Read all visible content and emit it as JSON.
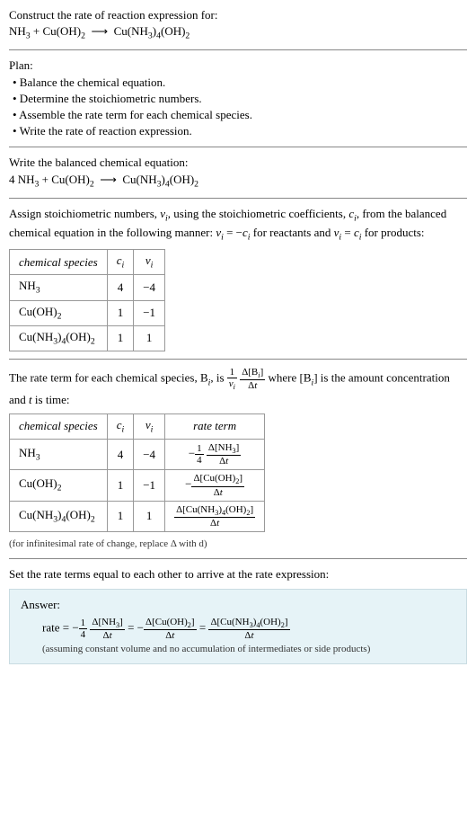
{
  "header": {
    "title": "Construct the rate of reaction expression for:",
    "equation_html": "NH<sub>3</sub> + Cu(OH)<sub>2</sub>&nbsp; ⟶ &nbsp;Cu(NH<sub>3</sub>)<sub>4</sub>(OH)<sub>2</sub>"
  },
  "plan": {
    "heading": "Plan:",
    "items": [
      "• Balance the chemical equation.",
      "• Determine the stoichiometric numbers.",
      "• Assemble the rate term for each chemical species.",
      "• Write the rate of reaction expression."
    ]
  },
  "balanced": {
    "heading": "Write the balanced chemical equation:",
    "equation_html": "4 NH<sub>3</sub> + Cu(OH)<sub>2</sub>&nbsp; ⟶ &nbsp;Cu(NH<sub>3</sub>)<sub>4</sub>(OH)<sub>2</sub>"
  },
  "stoich": {
    "intro_html": "Assign stoichiometric numbers, <i>ν<sub>i</sub></i>, using the stoichiometric coefficients, <i>c<sub>i</sub></i>, from the balanced chemical equation in the following manner: <i>ν<sub>i</sub></i> = −<i>c<sub>i</sub></i> for reactants and <i>ν<sub>i</sub></i> = <i>c<sub>i</sub></i> for products:",
    "headers": {
      "h1": "chemical species",
      "h2_html": "<i>c<sub>i</sub></i>",
      "h3_html": "<i>ν<sub>i</sub></i>"
    },
    "rows": [
      {
        "species_html": "NH<sub>3</sub>",
        "c": "4",
        "nu": "−4"
      },
      {
        "species_html": "Cu(OH)<sub>2</sub>",
        "c": "1",
        "nu": "−1"
      },
      {
        "species_html": "Cu(NH<sub>3</sub>)<sub>4</sub>(OH)<sub>2</sub>",
        "c": "1",
        "nu": "1"
      }
    ]
  },
  "rateterm": {
    "intro_pre": "The rate term for each chemical species, B",
    "intro_mid": ", is ",
    "intro_post": " where [B",
    "intro_tail": "] is the amount concentration and <i>t</i> is time:",
    "headers": {
      "h1": "chemical species",
      "h2_html": "<i>c<sub>i</sub></i>",
      "h3_html": "<i>ν<sub>i</sub></i>",
      "h4": "rate term"
    },
    "rows": [
      {
        "species_html": "NH<sub>3</sub>",
        "c": "4",
        "nu": "−4",
        "term_html": "−<span class='frac-inline'><span class='n'>1</span><span class='d'>4</span></span>&nbsp;<span class='frac-inline'><span class='n'>Δ[NH<sub>3</sub>]</span><span class='d'>Δ<i>t</i></span></span>"
      },
      {
        "species_html": "Cu(OH)<sub>2</sub>",
        "c": "1",
        "nu": "−1",
        "term_html": "−<span class='frac-inline'><span class='n'>Δ[Cu(OH)<sub>2</sub>]</span><span class='d'>Δ<i>t</i></span></span>"
      },
      {
        "species_html": "Cu(NH<sub>3</sub>)<sub>4</sub>(OH)<sub>2</sub>",
        "c": "1",
        "nu": "1",
        "term_html": "<span class='frac-inline'><span class='n'>Δ[Cu(NH<sub>3</sub>)<sub>4</sub>(OH)<sub>2</sub>]</span><span class='d'>Δ<i>t</i></span></span>"
      }
    ],
    "note": "(for infinitesimal rate of change, replace Δ with d)"
  },
  "final": {
    "heading": "Set the rate terms equal to each other to arrive at the rate expression:",
    "answer_label": "Answer:",
    "rate_html": "rate = −<span class='frac-inline'><span class='n'>1</span><span class='d'>4</span></span>&nbsp;<span class='frac-inline'><span class='n'>Δ[NH<sub>3</sub>]</span><span class='d'>Δ<i>t</i></span></span> = −<span class='frac-inline'><span class='n'>Δ[Cu(OH)<sub>2</sub>]</span><span class='d'>Δ<i>t</i></span></span> = <span class='frac-inline'><span class='n'>Δ[Cu(NH<sub>3</sub>)<sub>4</sub>(OH)<sub>2</sub>]</span><span class='d'>Δ<i>t</i></span></span>",
    "assume": "(assuming constant volume and no accumulation of intermediates or side products)"
  }
}
